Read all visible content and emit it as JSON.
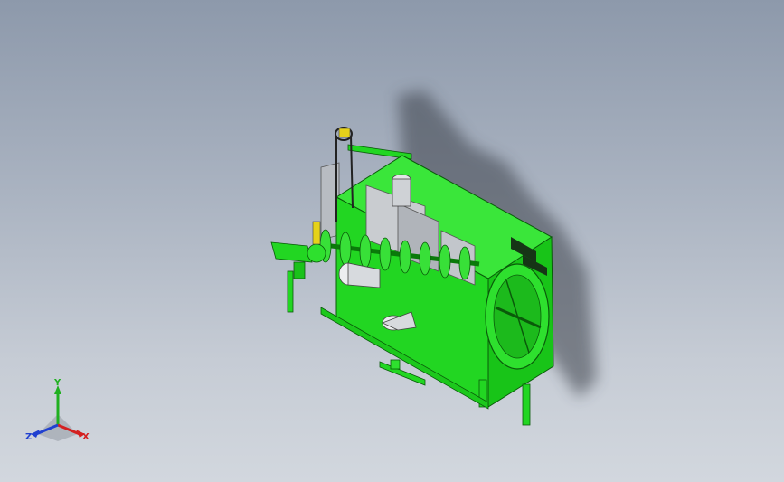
{
  "triad": {
    "x_label": "X",
    "y_label": "Y",
    "z_label": "Z",
    "x_color": "#d42020",
    "y_color": "#20b020",
    "z_color": "#2040d0"
  },
  "model": {
    "primary_color": "#22d622",
    "dark_green": "#119911",
    "light_green": "#5cf05c",
    "background_top": "#8d99ab",
    "background_bottom": "#d2d7de"
  }
}
